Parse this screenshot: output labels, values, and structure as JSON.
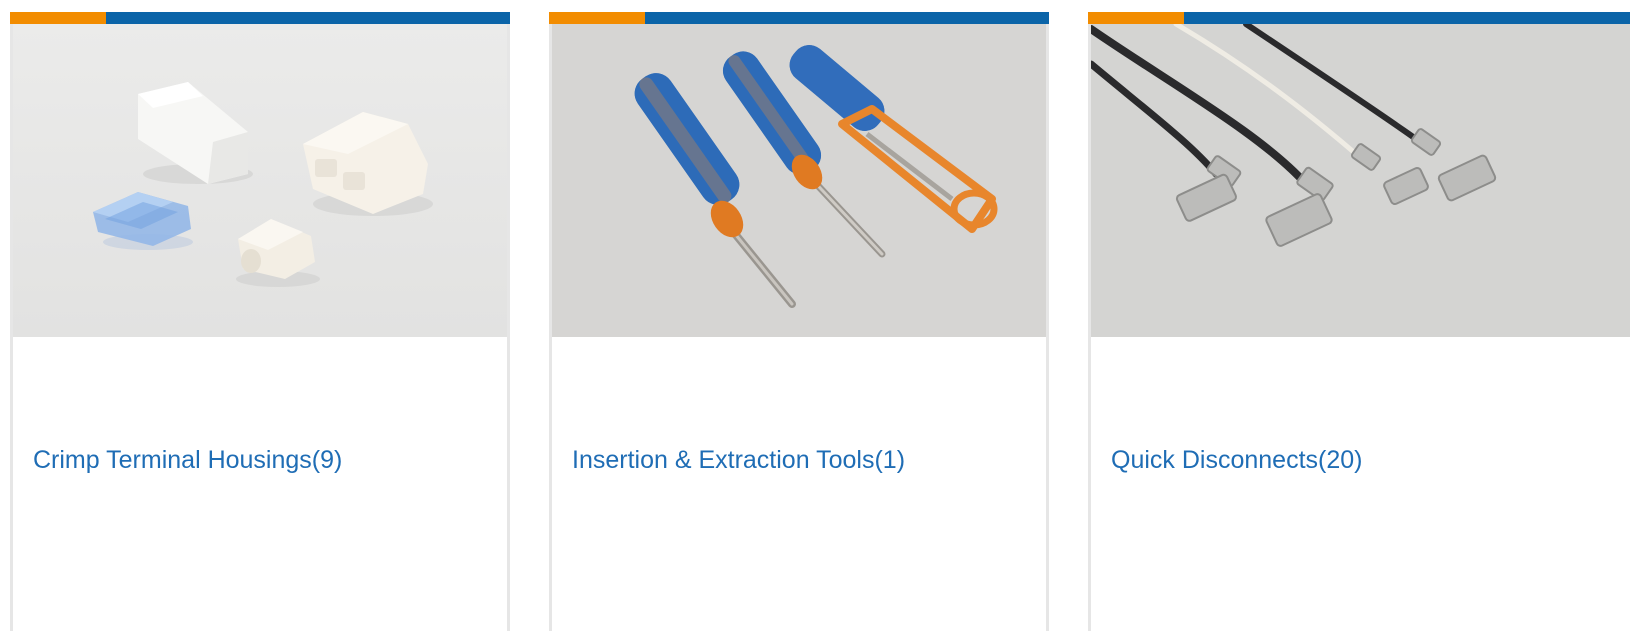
{
  "colors": {
    "accent_orange": "#f28c00",
    "accent_blue": "#0b64a8",
    "link_blue": "#1f6db5",
    "card_border": "#e6e6e6"
  },
  "cards": [
    {
      "label": "Crimp Terminal Housings(9)",
      "image": "crimp-terminal-housings-photo"
    },
    {
      "label": "Insertion & Extraction Tools(1)",
      "image": "insertion-extraction-tools-photo"
    },
    {
      "label": "Quick Disconnects(20)",
      "image": "quick-disconnects-photo"
    }
  ]
}
